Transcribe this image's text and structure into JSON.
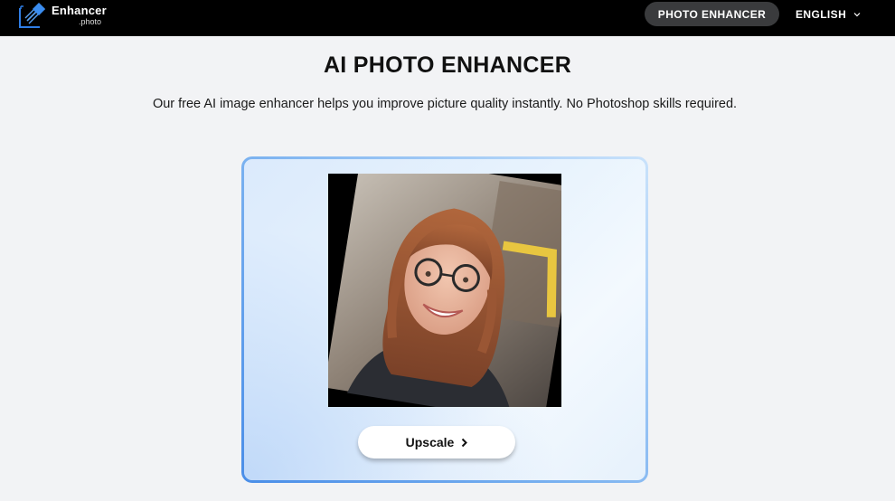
{
  "header": {
    "logo": {
      "name": "Enhancer",
      "sub": ".photo"
    },
    "nav_button": "PHOTO ENHANCER",
    "language": "ENGLISH"
  },
  "main": {
    "title": "AI PHOTO ENHANCER",
    "subtitle": "Our free AI image enhancer helps you improve picture quality instantly. No Photoshop skills required."
  },
  "card": {
    "upscale_label": "Upscale"
  },
  "colors": {
    "header_bg": "#000000",
    "nav_button_bg": "#3a3b3d",
    "accent_blue": "#4a8ee8",
    "page_bg": "#f2f3f5"
  },
  "icons": [
    "logo-icon",
    "chevron-down-icon",
    "chevron-right-icon"
  ]
}
